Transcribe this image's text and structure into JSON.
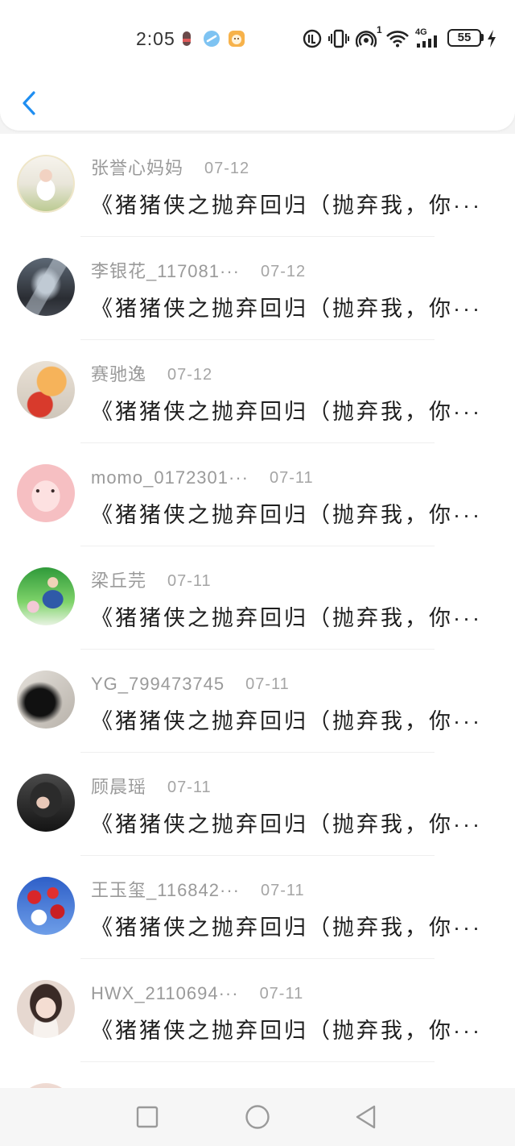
{
  "status_bar": {
    "time": "2:05",
    "hotspot_count": "1",
    "network": "4G",
    "battery": "55",
    "icons": [
      "recording-icon",
      "app-notification-icon",
      "app-notification-icon",
      "volte-icon",
      "vibrate-icon",
      "hotspot-icon",
      "wifi-icon",
      "signal-icon",
      "battery-icon",
      "charging-icon"
    ]
  },
  "theme": {
    "accent": "#1f8ef1"
  },
  "header": {
    "back_icon": "chevron-left-icon"
  },
  "messages": [
    {
      "name": "张誉心妈妈",
      "date": "07-12",
      "text": "《猪猪侠之抛弃回归（抛弃我，你···"
    },
    {
      "name": "李银花_117081···",
      "date": "07-12",
      "text": "《猪猪侠之抛弃回归（抛弃我，你···"
    },
    {
      "name": "赛驰逸",
      "date": "07-12",
      "text": "《猪猪侠之抛弃回归（抛弃我，你···"
    },
    {
      "name": "momo_0172301···",
      "date": "07-11",
      "text": "《猪猪侠之抛弃回归（抛弃我，你···"
    },
    {
      "name": "梁丘芫",
      "date": "07-11",
      "text": "《猪猪侠之抛弃回归（抛弃我，你···"
    },
    {
      "name": "YG_799473745",
      "date": "07-11",
      "text": "《猪猪侠之抛弃回归（抛弃我，你···"
    },
    {
      "name": "顾晨瑶",
      "date": "07-11",
      "text": "《猪猪侠之抛弃回归（抛弃我，你···"
    },
    {
      "name": "王玉玺_116842···",
      "date": "07-11",
      "text": "《猪猪侠之抛弃回归（抛弃我，你···"
    },
    {
      "name": "HWX_2110694···",
      "date": "07-11",
      "text": "《猪猪侠之抛弃回归（抛弃我，你···"
    }
  ],
  "nav_bar": {
    "icons": [
      "recents-square-icon",
      "home-circle-icon",
      "back-triangle-icon"
    ]
  }
}
